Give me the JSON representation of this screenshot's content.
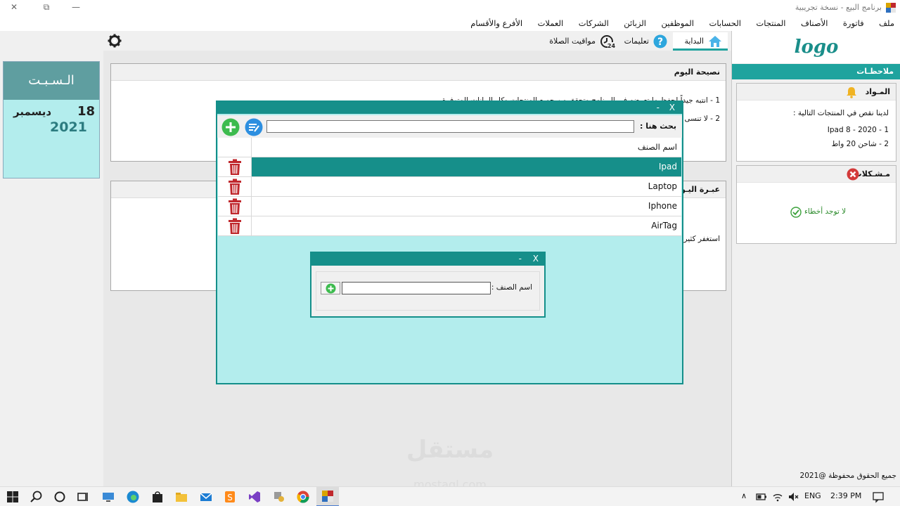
{
  "window": {
    "title": "برنامج البيع - نسخة تجريبية",
    "minimize": "—",
    "restore": "⧉",
    "close": "✕"
  },
  "menu": [
    "ملف",
    "فاتورة",
    "الأصناف",
    "المنتجات",
    "الحسابات",
    "الموظفين",
    "الزبائن",
    "الشركات",
    "العملات",
    "الأفرع والأقسام"
  ],
  "tabs": {
    "home": "البداية",
    "help": "تعليمات",
    "prayer": "مواقيت الصلاة"
  },
  "date": {
    "weekday": "الـسـبـت",
    "day": "18",
    "month": "ديسمبر",
    "year": "2021"
  },
  "tip_panel": {
    "title": "نصيحة اليوم",
    "line1": "1 - انتبه جيداً لحفظ ما تعرضه في البرنامج وتحقق من جميع المنتجات وكل البيانات المتوفرة",
    "line2": "2 - لا تنسى"
  },
  "phrase_panel": {
    "title": "عبـرة اليـوم",
    "line1": "استغفر كثيرا"
  },
  "sidebar": {
    "logo": "logo",
    "notes_title": "ملاحظـات",
    "materials": {
      "title": "المـواد",
      "intro": "لدينا نقص في المنتجات التالية :",
      "items": [
        "1 - Ipad 8 - 2020",
        "2 - شاحن 20 واط"
      ]
    },
    "problems": {
      "title": "مـشـكلات",
      "status": "لا توجد أخطاء"
    },
    "copyright": "جميع الحقوق محفوظة @2021"
  },
  "dialog": {
    "minimize": "-",
    "close": "X",
    "search_label": "بحث هنا :",
    "search_value": "",
    "column_header": "اسم الصنف",
    "rows": [
      "Ipad",
      "Laptop",
      "Iphone",
      "AirTag"
    ],
    "selected_row": 0
  },
  "subdialog": {
    "minimize": "-",
    "close": "X",
    "label": "اسم الصنف :",
    "value": ""
  },
  "watermark": {
    "main": "مستقل",
    "sub": "mostaql.com"
  },
  "taskbar": {
    "lang": "ENG",
    "time": "2:39 PM"
  },
  "colors": {
    "accent": "#1fa39e",
    "accent_dark": "#168f8a",
    "dialog_bg": "#b3eded",
    "delete_red": "#c0282d"
  }
}
